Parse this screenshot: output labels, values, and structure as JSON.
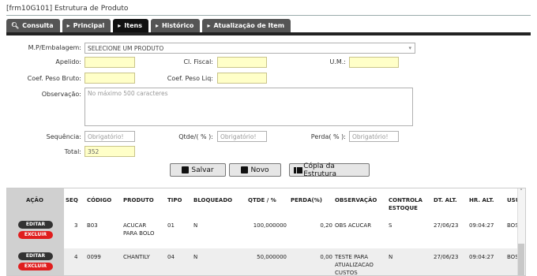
{
  "window": {
    "title": "[frm10G101] Estrutura de Produto"
  },
  "tabs": [
    {
      "label": "Consulta",
      "icon": "search-icon"
    },
    {
      "label": "Principal",
      "icon": "chevron-right-icon"
    },
    {
      "label": "Itens",
      "icon": "chevron-right-icon",
      "active": true
    },
    {
      "label": "Histórico",
      "icon": "chevron-right-icon"
    },
    {
      "label": "Atualização de Item",
      "icon": "chevron-right-icon"
    }
  ],
  "form": {
    "mp_label": "M.P/Embalagem:",
    "mp_value": "SELECIONE UM PRODUTO",
    "apelido_label": "Apelido:",
    "apelido_value": "",
    "clfiscal_label": "Cl. Fiscal:",
    "clfiscal_value": "",
    "um_label": "U.M.:",
    "um_value": "",
    "pesobruto_label": "Coef. Peso Bruto:",
    "pesobruto_value": "",
    "pesoliq_label": "Coef. Peso Liq:",
    "pesoliq_value": "",
    "obs_label": "Observação:",
    "obs_placeholder": "No máximo 500 caracteres",
    "seq_label": "Sequência:",
    "seq_placeholder": "Obrigatório!",
    "qtde_label": "Qtde/( % ):",
    "qtde_placeholder": "Obrigatório!",
    "perda_label": "Perda( % ):",
    "perda_placeholder": "Obrigatório!",
    "total_label": "Total:",
    "total_value": "352"
  },
  "buttons": {
    "salvar": "Salvar",
    "novo": "Novo",
    "copia": "Cópia da Estrutura"
  },
  "table": {
    "headers": {
      "acao": "AÇÃO",
      "seq": "SEQ",
      "codigo": "CÓDIGO",
      "produto": "PRODUTO",
      "tipo": "TIPO",
      "bloqueado": "BLOQUEADO",
      "qtde": "QTDE / %",
      "perda": "PERDA(%)",
      "observacao": "OBSERVAÇÃO",
      "controla1": "CONTROLA",
      "controla2": "ESTOQUE",
      "dtalt": "DT. ALT.",
      "hralt": "HR. ALT.",
      "usu": "USU"
    },
    "edit_label": "EDITAR",
    "delete_label": "EXCLUIR",
    "rows": [
      {
        "seq": "3",
        "codigo": "B03",
        "produto1": "ACUCAR",
        "produto2": "PARA BOLO",
        "tipo": "01",
        "bloqueado": "N",
        "qtde": "100,000000",
        "perda": "0,20",
        "obs1": "OBS ACUCAR",
        "obs2": "",
        "obs3": "",
        "controla": "S",
        "dtalt": "27/06/23",
        "hralt": "09:04:27",
        "usu": "BOS"
      },
      {
        "seq": "4",
        "codigo": "0099",
        "produto1": "CHANTILY",
        "produto2": "",
        "tipo": "04",
        "bloqueado": "N",
        "qtde": "50,000000",
        "perda": "0,00",
        "obs1": "TESTE PARA",
        "obs2": "ATUALIZACAO",
        "obs3": "CUSTOS",
        "controla": "N",
        "dtalt": "27/06/23",
        "hralt": "09:04:27",
        "usu": "BOS"
      }
    ]
  },
  "colors": {
    "required_bg": "#ffffc8",
    "delete": "#e01e1e",
    "tab_active": "#111111"
  }
}
